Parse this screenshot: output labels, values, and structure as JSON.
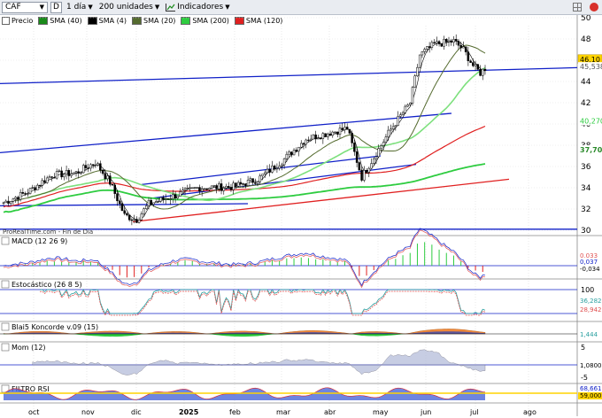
{
  "toolbar": {
    "ticker": "CAF",
    "d_label": "D",
    "period": "1 día",
    "units": "200 unidades",
    "indicators": "Indicadores"
  },
  "legend": [
    {
      "label": "Precio",
      "color": "#000000"
    },
    {
      "label": "SMA (40)",
      "color": "#1a8a1a"
    },
    {
      "label": "SMA (4)",
      "color": "#000000"
    },
    {
      "label": "SMA (20)",
      "color": "#556b2f"
    },
    {
      "label": "SMA (200)",
      "color": "#2ecc40"
    },
    {
      "label": "SMA (120)",
      "color": "#e02020"
    }
  ],
  "main_axis": {
    "ticks": [
      "50",
      "48",
      "46",
      "44",
      "42",
      "40",
      "38",
      "36",
      "34",
      "32",
      "30"
    ],
    "price_labels": [
      {
        "text": "46,10",
        "bg": "#ffd400",
        "color": "#000"
      },
      {
        "text": "45,538",
        "bg": "#ffffff",
        "color": "#555"
      },
      {
        "text": "40,270",
        "bg": "#ffffff",
        "color": "#2ecc40"
      },
      {
        "text": "37,70",
        "bg": "#ffffff",
        "color": "#2a8a2a"
      }
    ]
  },
  "watermark": "ProRealTime.com - Fin de Día",
  "panels": {
    "macd": {
      "title": "MACD (12 26 9)",
      "labels": [
        "0,033",
        "0,037",
        "-0,034"
      ]
    },
    "stoch": {
      "title": "Estocástico (26 8 5)",
      "ticks": [
        "100",
        "0"
      ],
      "labels": [
        "36,282",
        "28,942"
      ]
    },
    "blai": {
      "title": "Blai5 Koncorde v.09 (15)",
      "labels": [
        "1,444"
      ]
    },
    "mom": {
      "title": "Mom (12)",
      "ticks": [
        "5",
        "-5"
      ],
      "labels": [
        "1,0800"
      ]
    },
    "rsi": {
      "title": "FILTRO RSI",
      "labels": [
        "68,661",
        "59,000"
      ]
    }
  },
  "x_labels": [
    "oct",
    "nov",
    "dic",
    "2025",
    "feb",
    "mar",
    "abr",
    "may",
    "jun",
    "jul",
    "ago"
  ],
  "colors": {
    "candle_up": "#000000",
    "candle_down": "#000000",
    "trend_blue": "#1020c8",
    "trend_red": "#e02020"
  }
}
